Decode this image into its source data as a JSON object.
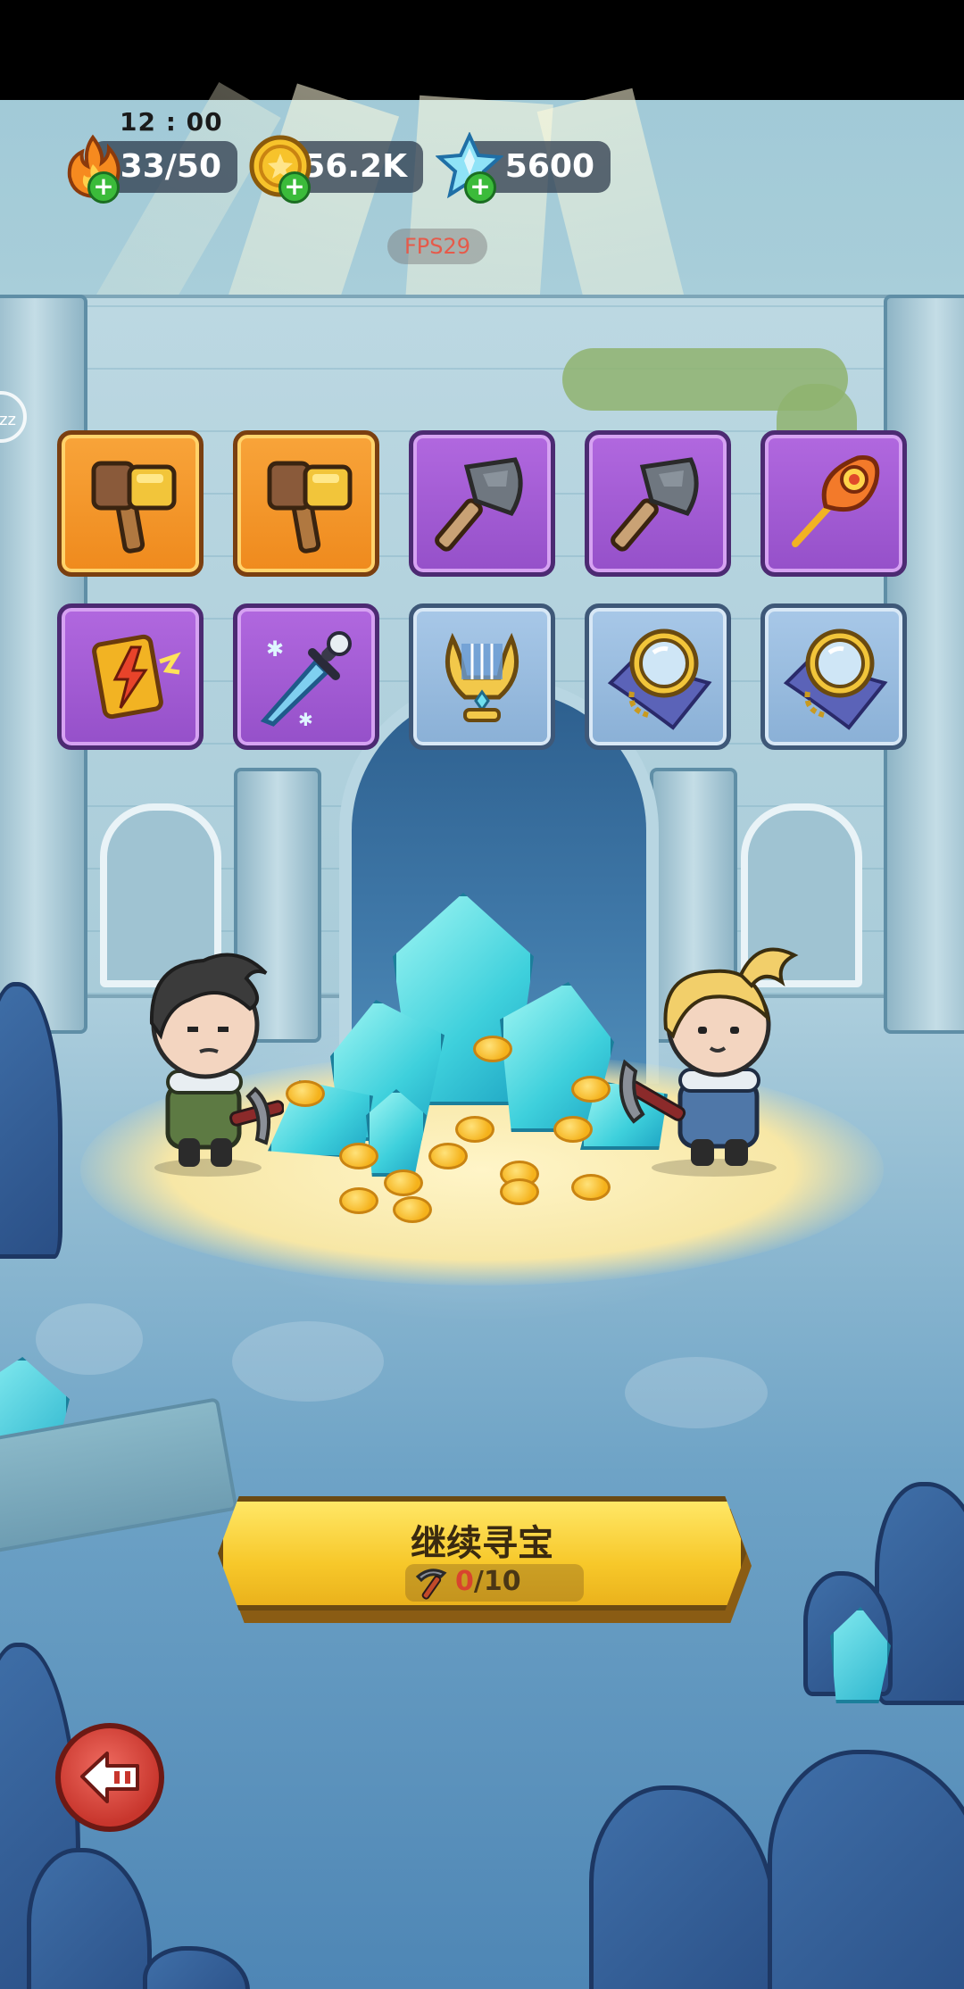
{
  "status": {
    "time": "12 : 00"
  },
  "resources": {
    "energy": {
      "icon": "flame-icon",
      "value": "33/50"
    },
    "gold": {
      "icon": "gold-coin-icon",
      "value": "56.2K"
    },
    "gems": {
      "icon": "ice-crystal-icon",
      "value": "5600"
    }
  },
  "debug": {
    "fps": "FPS29"
  },
  "items": [
    {
      "name": "golden-hammer",
      "rarity": "orange"
    },
    {
      "name": "golden-hammer",
      "rarity": "orange"
    },
    {
      "name": "stone-axe",
      "rarity": "purple"
    },
    {
      "name": "stone-axe",
      "rarity": "purple"
    },
    {
      "name": "phoenix-feather",
      "rarity": "purple"
    },
    {
      "name": "lightning-scroll",
      "rarity": "purple"
    },
    {
      "name": "frost-dagger",
      "rarity": "purple"
    },
    {
      "name": "golden-lyre",
      "rarity": "blue"
    },
    {
      "name": "magnifying-glass",
      "rarity": "blue"
    },
    {
      "name": "magnifying-glass",
      "rarity": "blue"
    }
  ],
  "continue_button": {
    "label": "继续寻宝",
    "count_current": "0",
    "count_total": "/10"
  },
  "colors": {
    "orange_rarity": "#f49a2c",
    "purple_rarity": "#a25dd3",
    "blue_rarity": "#9bbde0",
    "button": "#f7c82a",
    "back_button": "#d9463c"
  }
}
